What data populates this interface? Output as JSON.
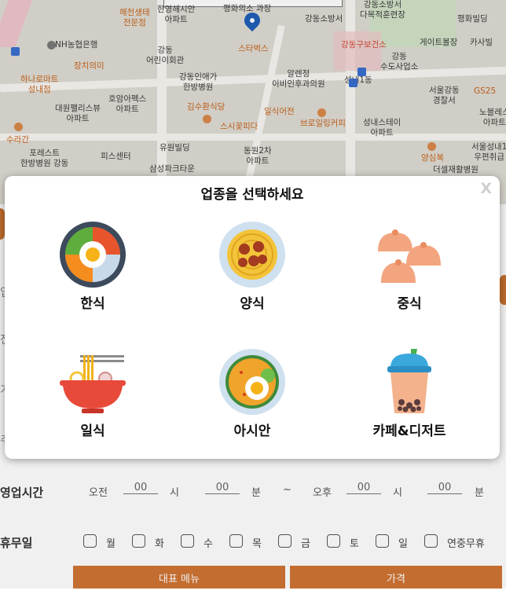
{
  "map": {
    "pois": [
      {
        "id": "haecheon",
        "text": "해천생태\n전문점",
        "color": "o"
      },
      {
        "id": "hanyoung",
        "text": "한영해시안\n아파트",
        "color": "g"
      },
      {
        "id": "peace",
        "text": "평화의소 과장",
        "color": "g"
      },
      {
        "id": "gangdong-fire",
        "text": "강동소방서",
        "color": "g"
      },
      {
        "id": "gangdong-fire-ctr",
        "text": "강동소방서\n다목적훈련장",
        "color": "g"
      },
      {
        "id": "peace-bldg",
        "text": "평화빌딩",
        "color": "g"
      },
      {
        "id": "nh",
        "text": "NH농협은행",
        "color": "g"
      },
      {
        "id": "starbucks",
        "text": "스타벅스",
        "color": "o"
      },
      {
        "id": "health",
        "text": "강동구보건소",
        "color": "r"
      },
      {
        "id": "gateway",
        "text": "게이트볼장",
        "color": "g"
      },
      {
        "id": "kasa",
        "text": "카사빌",
        "color": "g"
      },
      {
        "id": "jangchi",
        "text": "장치의미",
        "color": "o"
      },
      {
        "id": "gangdong-kids",
        "text": "강동\n어린이회관",
        "color": "g"
      },
      {
        "id": "gangdong-water",
        "text": "강동\n수도사업소",
        "color": "g"
      },
      {
        "id": "hanaro",
        "text": "하나로마트\n성내점",
        "color": "o"
      },
      {
        "id": "gangdong-inae",
        "text": "강동인애가\n한방병원",
        "color": "g"
      },
      {
        "id": "allergen",
        "text": "알렌정\n이비인후과의원",
        "color": "g"
      },
      {
        "id": "seongnae1",
        "text": "성내1동",
        "color": "g"
      },
      {
        "id": "seoul-police",
        "text": "서울강동\n경찰서",
        "color": "g"
      },
      {
        "id": "gs25",
        "text": "GS25",
        "color": "o"
      },
      {
        "id": "daewon",
        "text": "대원팰리스뷰\n아파트",
        "color": "g"
      },
      {
        "id": "hoam",
        "text": "호암아펙스\n아파트",
        "color": "g"
      },
      {
        "id": "kimsu",
        "text": "김수환식당",
        "color": "o"
      },
      {
        "id": "ilsik",
        "text": "일식어전",
        "color": "o"
      },
      {
        "id": "nobel",
        "text": "노블레스\n아파트",
        "color": "g"
      },
      {
        "id": "sushi",
        "text": "스시꽃피다",
        "color": "o"
      },
      {
        "id": "brooklyn",
        "text": "브로일링커피",
        "color": "o"
      },
      {
        "id": "seongnae-stay",
        "text": "성내스테이\n아파트",
        "color": "g"
      },
      {
        "id": "suralgan",
        "text": "수라간",
        "color": "o"
      },
      {
        "id": "yuwon",
        "text": "유원빌딩",
        "color": "g"
      },
      {
        "id": "dongwon",
        "text": "동원2차\n아파트",
        "color": "g"
      },
      {
        "id": "yangsik",
        "text": "양심복",
        "color": "o"
      },
      {
        "id": "seoul-seongnae",
        "text": "서울성내1\n우편취급",
        "color": "g"
      },
      {
        "id": "forest",
        "text": "포레스트\n한방병원 강동",
        "color": "g"
      },
      {
        "id": "fitness",
        "text": "피스센터",
        "color": "g"
      },
      {
        "id": "samsung",
        "text": "삼성파크타운",
        "color": "g"
      },
      {
        "id": "dethel",
        "text": "더셀재활병원",
        "color": "g"
      }
    ]
  },
  "form": {
    "hours_label": "영업시간",
    "am": "오전",
    "pm": "오후",
    "open_hour": "00",
    "open_min": "00",
    "close_hour": "00",
    "close_min": "00",
    "hour_unit": "시",
    "min_unit": "분",
    "tilde": "~",
    "holiday_label": "휴무일",
    "days": [
      "월",
      "화",
      "수",
      "목",
      "금",
      "토",
      "일",
      "연중무휴"
    ],
    "menu_button": "대표 메뉴",
    "price_button": "가격",
    "ghost_labels": [
      "입",
      "전",
      "가",
      "주"
    ]
  },
  "modal": {
    "title": "업종을 선택하세요",
    "close": "X",
    "categories": [
      {
        "label": "한식",
        "icon": "bibimbap-icon"
      },
      {
        "label": "양식",
        "icon": "pasta-icon"
      },
      {
        "label": "중식",
        "icon": "dumpling-icon"
      },
      {
        "label": "일식",
        "icon": "ramen-icon"
      },
      {
        "label": "아시안",
        "icon": "curry-icon"
      },
      {
        "label": "카페&디저트",
        "icon": "bubble-tea-icon"
      }
    ]
  },
  "colors": {
    "accent": "#d07434",
    "modal_bg": "#ffffff",
    "map_bg": "#e9e6e0"
  }
}
